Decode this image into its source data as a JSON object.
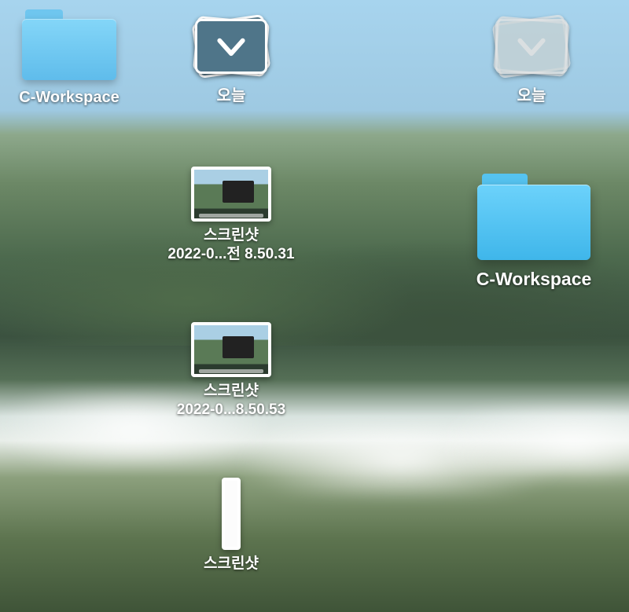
{
  "left": {
    "folder": {
      "label": "C-Workspace"
    },
    "stack": {
      "label": "오늘"
    },
    "shots": [
      {
        "line1": "스크린샷",
        "line2": "2022-0...전 8.50.31"
      },
      {
        "line1": "스크린샷",
        "line2": "2022-0...8.50.53"
      },
      {
        "line1": "스크린샷"
      }
    ]
  },
  "right": {
    "stack": {
      "label": "오늘"
    },
    "folder": {
      "label": "C-Workspace"
    }
  }
}
